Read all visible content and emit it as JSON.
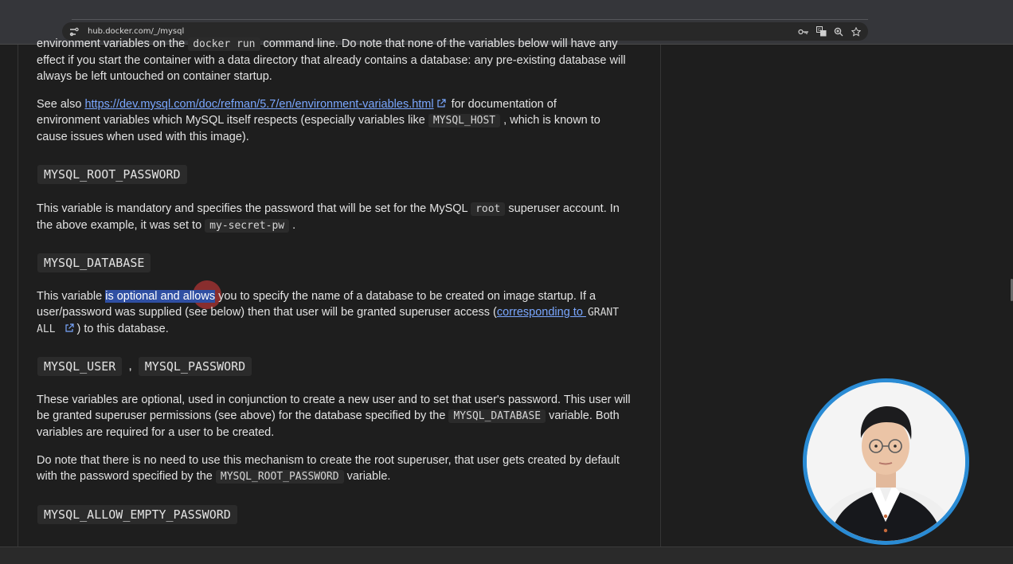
{
  "browser": {
    "url": "hub.docker.com/_/mysql"
  },
  "doc": {
    "intro_lines": [
      "environment variables on the ",
      "docker run",
      " command line. Do note that none of the variables below will have any",
      "effect if you start the container with a data directory that already contains a database: any pre-existing database will",
      "always be left untouched on container startup."
    ],
    "see_also": {
      "prefix": "See also ",
      "link": "https://dev.mysql.com/doc/refman/5.7/en/environment-variables.html",
      "after_link": " for documentation of",
      "line2_a": "environment variables which MySQL itself respects (especially variables like ",
      "code": "MYSQL_HOST",
      "line2_b": " , which is known to",
      "line3": "cause issues when used with this image)."
    },
    "root_password": {
      "heading": "MYSQL_ROOT_PASSWORD",
      "p1_a": "This variable is mandatory and specifies the password that will be set for the MySQL ",
      "p1_code": "root",
      "p1_b": " superuser account. In",
      "p2_a": "the above example, it was set to ",
      "p2_code": "my-secret-pw",
      "p2_b": " ."
    },
    "database": {
      "heading": "MYSQL_DATABASE",
      "l1_a": "This variable ",
      "l1_sel": "is optional and allows",
      "l1_b": " you to specify the name of a database to be created on image startup. If a",
      "l2_a": "user/password was supplied (see below) then that user will be granted superuser access (",
      "l2_link": "corresponding to ",
      "l2_code1": "GRANT",
      "l3_code2": "ALL",
      "l3_b": ") to this database."
    },
    "user_password": {
      "heading_a": "MYSQL_USER",
      "heading_sep": ",",
      "heading_b": "MYSQL_PASSWORD",
      "p1_l1": "These variables are optional, used in conjunction to create a new user and to set that user's password. This user will",
      "p1_l2_a": "be granted superuser permissions (see above) for the database specified by the ",
      "p1_l2_code": "MYSQL_DATABASE",
      "p1_l2_b": " variable. Both",
      "p1_l3": "variables are required for a user to be created.",
      "p2_l1": "Do note that there is no need to use this mechanism to create the root superuser, that user gets created by default",
      "p2_l2_a": "with the password specified by the ",
      "p2_l2_code": "MYSQL_ROOT_PASSWORD",
      "p2_l2_b": " variable."
    },
    "allow_empty": {
      "heading": "MYSQL_ALLOW_EMPTY_PASSWORD"
    }
  },
  "icons": {
    "site": "site-info-icon",
    "key": "password-key-icon",
    "translate": "translate-icon",
    "zoom": "zoom-icon",
    "star": "bookmark-star-icon",
    "external": "external-link-icon"
  },
  "colors": {
    "link": "#7aa7ff",
    "selection": "#2f4fa3",
    "webcam_ring": "#2a8bd4"
  }
}
